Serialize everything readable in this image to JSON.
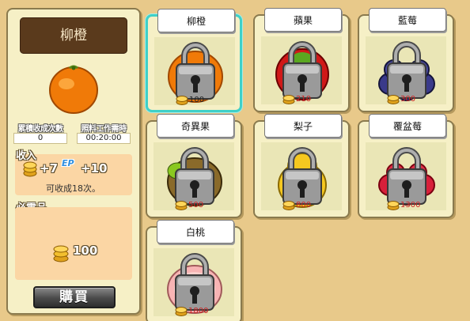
{
  "detail": {
    "title": "柳橙",
    "stat1_label": "累積收成次數",
    "stat1_value": "0",
    "stat2_label": "照料工作需時",
    "stat2_value": "00:20:00",
    "income_label": "收入",
    "gold_gain": "+7",
    "exp_badge": "EP",
    "exp_gain": "+10",
    "harvest_text": "可收成18次。",
    "required_label": "必需品",
    "required_amount": "100",
    "buy_label": "購買"
  },
  "cards": [
    {
      "name": "柳橙",
      "price": "100",
      "fruit": "orange",
      "selected": true
    },
    {
      "name": "蘋果",
      "price": "210",
      "fruit": "apple"
    },
    {
      "name": "藍莓",
      "price": "300",
      "fruit": "blueberry"
    },
    {
      "name": "奇異果",
      "price": "500",
      "fruit": "kiwi"
    },
    {
      "name": "梨子",
      "price": "800",
      "fruit": "pear"
    },
    {
      "name": "覆盆莓",
      "price": "1300",
      "fruit": "raspberry"
    },
    {
      "name": "白桃",
      "price": "1800",
      "fruit": "peach"
    }
  ],
  "icons": {
    "lock": "padlock-icon",
    "coin": "gold-coins-icon",
    "exp": "exp-badge-icon"
  },
  "colors": {
    "background": "#e8c98a",
    "panel": "#f6f0c6",
    "title_bar": "#5a3a1c",
    "selected_border": "#3fd0c8",
    "price_red": "#c22222"
  }
}
